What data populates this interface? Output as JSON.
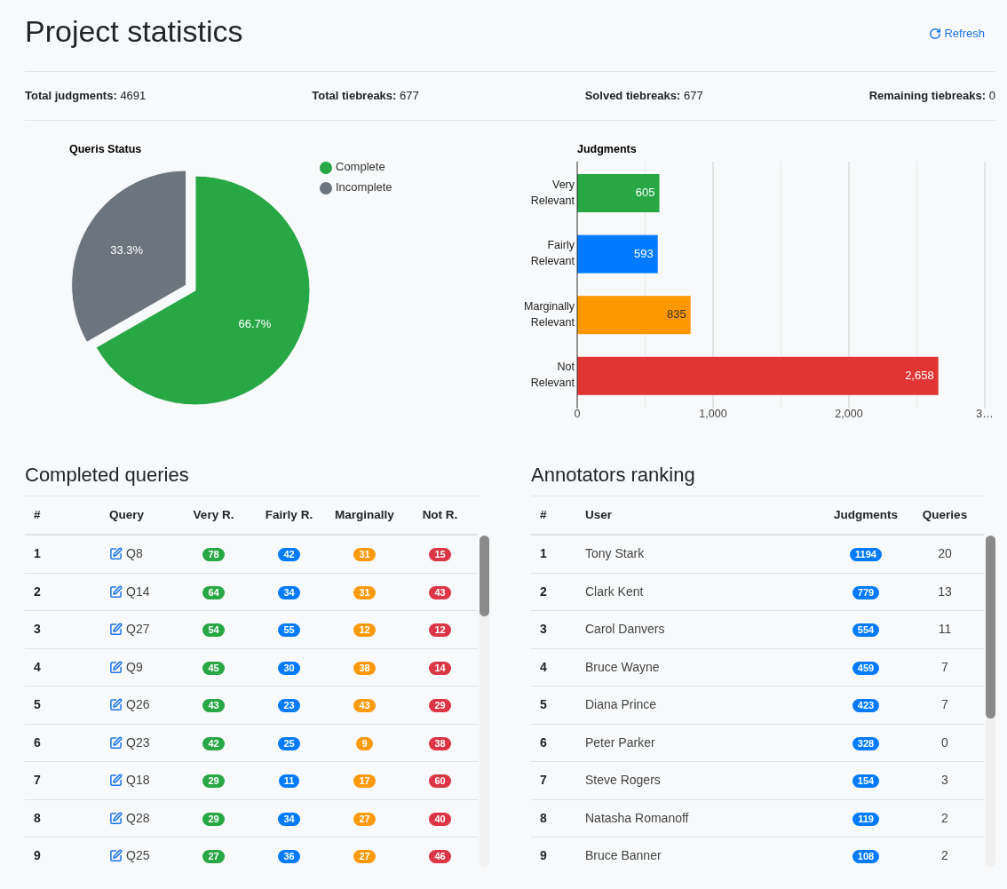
{
  "header": {
    "title": "Project statistics",
    "refresh": "Refresh"
  },
  "stats": [
    "**Total judgments:** 4691",
    "**Total tiebreaks:** 677",
    "**Solved tiebreaks:** 677",
    "**Remaining tiebreaks:** 0"
  ],
  "status_chart": {
    "chart_data": {
      "type": "pie",
      "title": "Queris Status",
      "categories": [
        "Complete",
        "Incomplete"
      ],
      "values": [
        66.7,
        33.3
      ],
      "legend": true,
      "colors": [
        "#28a745",
        "#6c757d"
      ],
      "value_labels": [
        "66.7%",
        "33.3%"
      ]
    }
  },
  "judgments_chart": {
    "chart_data": {
      "type": "bar",
      "orientation": "horizontal",
      "title": "Judgments",
      "categories": [
        "Very Relevant",
        "Fairly Relevant",
        "Marginally Relevant",
        "Not Relevant"
      ],
      "values": [
        605,
        593,
        835,
        2658
      ],
      "colors": [
        "#28a745",
        "#007bff",
        "#ff9800",
        "#e03532"
      ],
      "value_labels": [
        "605",
        "593",
        "835",
        "2,658"
      ],
      "xlim": [
        0,
        3000
      ],
      "xticks": [
        0,
        {
          "value": 1000,
          "label": "1,000"
        },
        {
          "value": 2000,
          "label": "2,000"
        },
        {
          "value": 3000,
          "label": "3…"
        }
      ]
    }
  },
  "completed_queries": {
    "title": "Completed queries",
    "columns": [
      {
        "label": "#"
      },
      {
        "label": "Query"
      },
      {
        "label": "Very R.",
        "color": "#28a745"
      },
      {
        "label": "Fairly R.",
        "color": "#007bff"
      },
      {
        "label": "Marginally",
        "color": "#fd9a0c"
      },
      {
        "label": "Not R.",
        "color": "#dc3545"
      }
    ],
    "rows": [
      {
        "rank": "1",
        "query": "Q8",
        "counts": [
          "78",
          "42",
          "31",
          "15"
        ]
      },
      {
        "rank": "2",
        "query": "Q14",
        "counts": [
          "64",
          "34",
          "31",
          "43"
        ]
      },
      {
        "rank": "3",
        "query": "Q27",
        "counts": [
          "54",
          "55",
          "12",
          "12"
        ]
      },
      {
        "rank": "4",
        "query": "Q9",
        "counts": [
          "45",
          "30",
          "38",
          "14"
        ]
      },
      {
        "rank": "5",
        "query": "Q26",
        "counts": [
          "43",
          "23",
          "43",
          "29"
        ]
      },
      {
        "rank": "6",
        "query": "Q23",
        "counts": [
          "42",
          "25",
          "9",
          "38"
        ]
      },
      {
        "rank": "7",
        "query": "Q18",
        "counts": [
          "29",
          "11",
          "17",
          "60"
        ]
      },
      {
        "rank": "8",
        "query": "Q28",
        "counts": [
          "29",
          "34",
          "27",
          "40"
        ]
      },
      {
        "rank": "9",
        "query": "Q25",
        "counts": [
          "27",
          "36",
          "27",
          "46"
        ]
      }
    ]
  },
  "annotators_ranking": {
    "title": "Annotators ranking",
    "columns": [
      "#",
      "User",
      "Judgments",
      "Queries"
    ],
    "rows": [
      {
        "rank": "1",
        "user": "Tony Stark",
        "judgments": "1194",
        "queries": "20"
      },
      {
        "rank": "2",
        "user": "Clark Kent",
        "judgments": "779",
        "queries": "13"
      },
      {
        "rank": "3",
        "user": "Carol Danvers",
        "judgments": "554",
        "queries": "11"
      },
      {
        "rank": "4",
        "user": "Bruce Wayne",
        "judgments": "459",
        "queries": "7"
      },
      {
        "rank": "5",
        "user": "Diana Prince",
        "judgments": "423",
        "queries": "7"
      },
      {
        "rank": "6",
        "user": "Peter Parker",
        "judgments": "328",
        "queries": "0"
      },
      {
        "rank": "7",
        "user": "Steve Rogers",
        "judgments": "154",
        "queries": "3"
      },
      {
        "rank": "8",
        "user": "Natasha Romanoff",
        "judgments": "119",
        "queries": "2"
      },
      {
        "rank": "9",
        "user": "Bruce Banner",
        "judgments": "108",
        "queries": "2"
      }
    ]
  }
}
